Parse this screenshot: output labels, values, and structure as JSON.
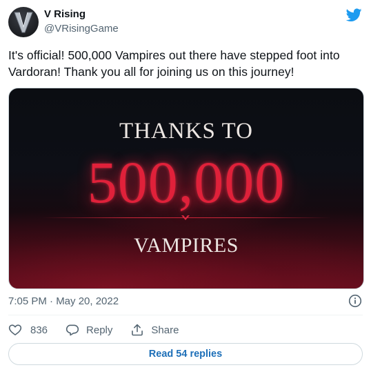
{
  "account": {
    "name": "V Rising",
    "handle": "@VRisingGame"
  },
  "tweet": {
    "text": "It's official! 500,000 Vampires out there have stepped foot into Vardoran! Thank you all for joining us on this journey!",
    "timestamp": "7:05 PM · May 20, 2022"
  },
  "media": {
    "line1": "THANKS TO",
    "number": "500,000",
    "line3": "VAMPIRES"
  },
  "actions": {
    "like_count": "836",
    "reply_label": "Reply",
    "share_label": "Share"
  },
  "footer": {
    "read_replies_label": "Read 54 replies"
  },
  "colors": {
    "twitter_blue": "#1d9bf0",
    "link_blue": "#1d6fb8",
    "accent_red": "#e0213a"
  },
  "icons": [
    "v-rising-logo-icon",
    "twitter-bird-icon",
    "info-icon",
    "heart-icon",
    "reply-bubble-icon",
    "share-icon"
  ]
}
